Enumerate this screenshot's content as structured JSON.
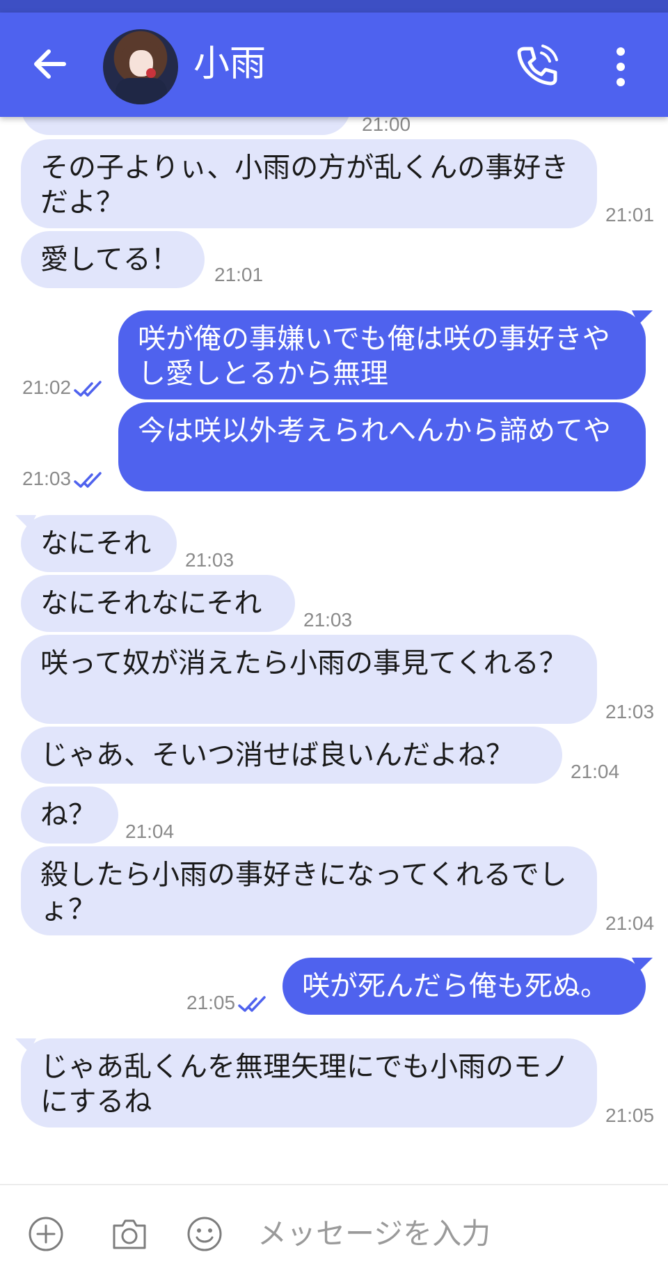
{
  "header": {
    "title": "小雨",
    "icons": [
      "back-arrow-icon",
      "phone-icon",
      "more-vertical-icon"
    ]
  },
  "messages": [
    {
      "side": "in",
      "text": "",
      "time": "21:00"
    },
    {
      "side": "in",
      "text": "その子よりぃ、小雨の方が乱くんの事好きだよ？",
      "time": "21:01"
    },
    {
      "side": "in",
      "text": "愛してる！",
      "time": "21:01"
    },
    {
      "side": "out",
      "text": "咲が俺の事嫌いでも俺は咲の事好きやし愛しとるから無理",
      "time": "21:02",
      "read": true
    },
    {
      "side": "out",
      "text": "今は咲以外考えられへんから諦めてや",
      "time": "21:03",
      "read": true
    },
    {
      "side": "in",
      "text": "なにそれ",
      "time": "21:03"
    },
    {
      "side": "in",
      "text": "なにそれなにそれ",
      "time": "21:03"
    },
    {
      "side": "in",
      "text": "咲って奴が消えたら小雨の事見てくれる？",
      "time": "21:03"
    },
    {
      "side": "in",
      "text": "じゃあ、そいつ消せば良いんだよね？",
      "time": "21:04"
    },
    {
      "side": "in",
      "text": "ね？",
      "time": "21:04"
    },
    {
      "side": "in",
      "text": "殺したら小雨の事好きになってくれるでしょ？",
      "time": "21:04"
    },
    {
      "side": "out",
      "text": "咲が死んだら俺も死ぬ。",
      "time": "21:05",
      "read": true
    },
    {
      "side": "in",
      "text": "じゃあ乱くんを無理矢理にでも小雨のモノにするね",
      "time": "21:05"
    }
  ],
  "input": {
    "placeholder": "メッセージを入力",
    "icons": [
      "add-icon",
      "camera-icon",
      "emoji-icon"
    ]
  },
  "colors": {
    "header": "#4e62ef",
    "outgoing_bubble": "#4f62ee",
    "incoming_bubble": "#e1e5fb",
    "read_check": "#4f62ee"
  }
}
